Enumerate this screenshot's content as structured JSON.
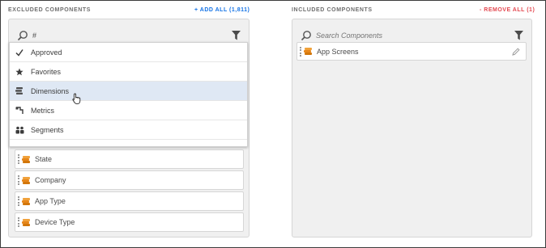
{
  "excluded": {
    "header": "EXCLUDED COMPONENTS",
    "add_all_label": "+ ADD ALL (1,811)",
    "search_value": "#",
    "filter_icon": "filter-icon",
    "dropdown": [
      {
        "label": "Approved",
        "icon": "checkmark-icon"
      },
      {
        "label": "Favorites",
        "icon": "star-icon"
      },
      {
        "label": "Dimensions",
        "icon": "dimension-icon"
      },
      {
        "label": "Metrics",
        "icon": "metric-icon"
      },
      {
        "label": "Segments",
        "icon": "segment-icon"
      }
    ],
    "selected_filter": "Dimensions",
    "items": [
      {
        "label": "State"
      },
      {
        "label": "Company"
      },
      {
        "label": "App Type"
      },
      {
        "label": "Device Type"
      }
    ]
  },
  "included": {
    "header": "INCLUDED COMPONENTS",
    "remove_all_label": "- REMOVE ALL (1)",
    "search_placeholder": "Search Components",
    "items": [
      {
        "label": "App Screens"
      }
    ]
  },
  "colors": {
    "add_link": "#1473e6",
    "remove_link": "#e34850",
    "dimension_orange": "#e68619",
    "selected_row": "#dfe8f4",
    "panel_bg": "#f0f0f0"
  }
}
